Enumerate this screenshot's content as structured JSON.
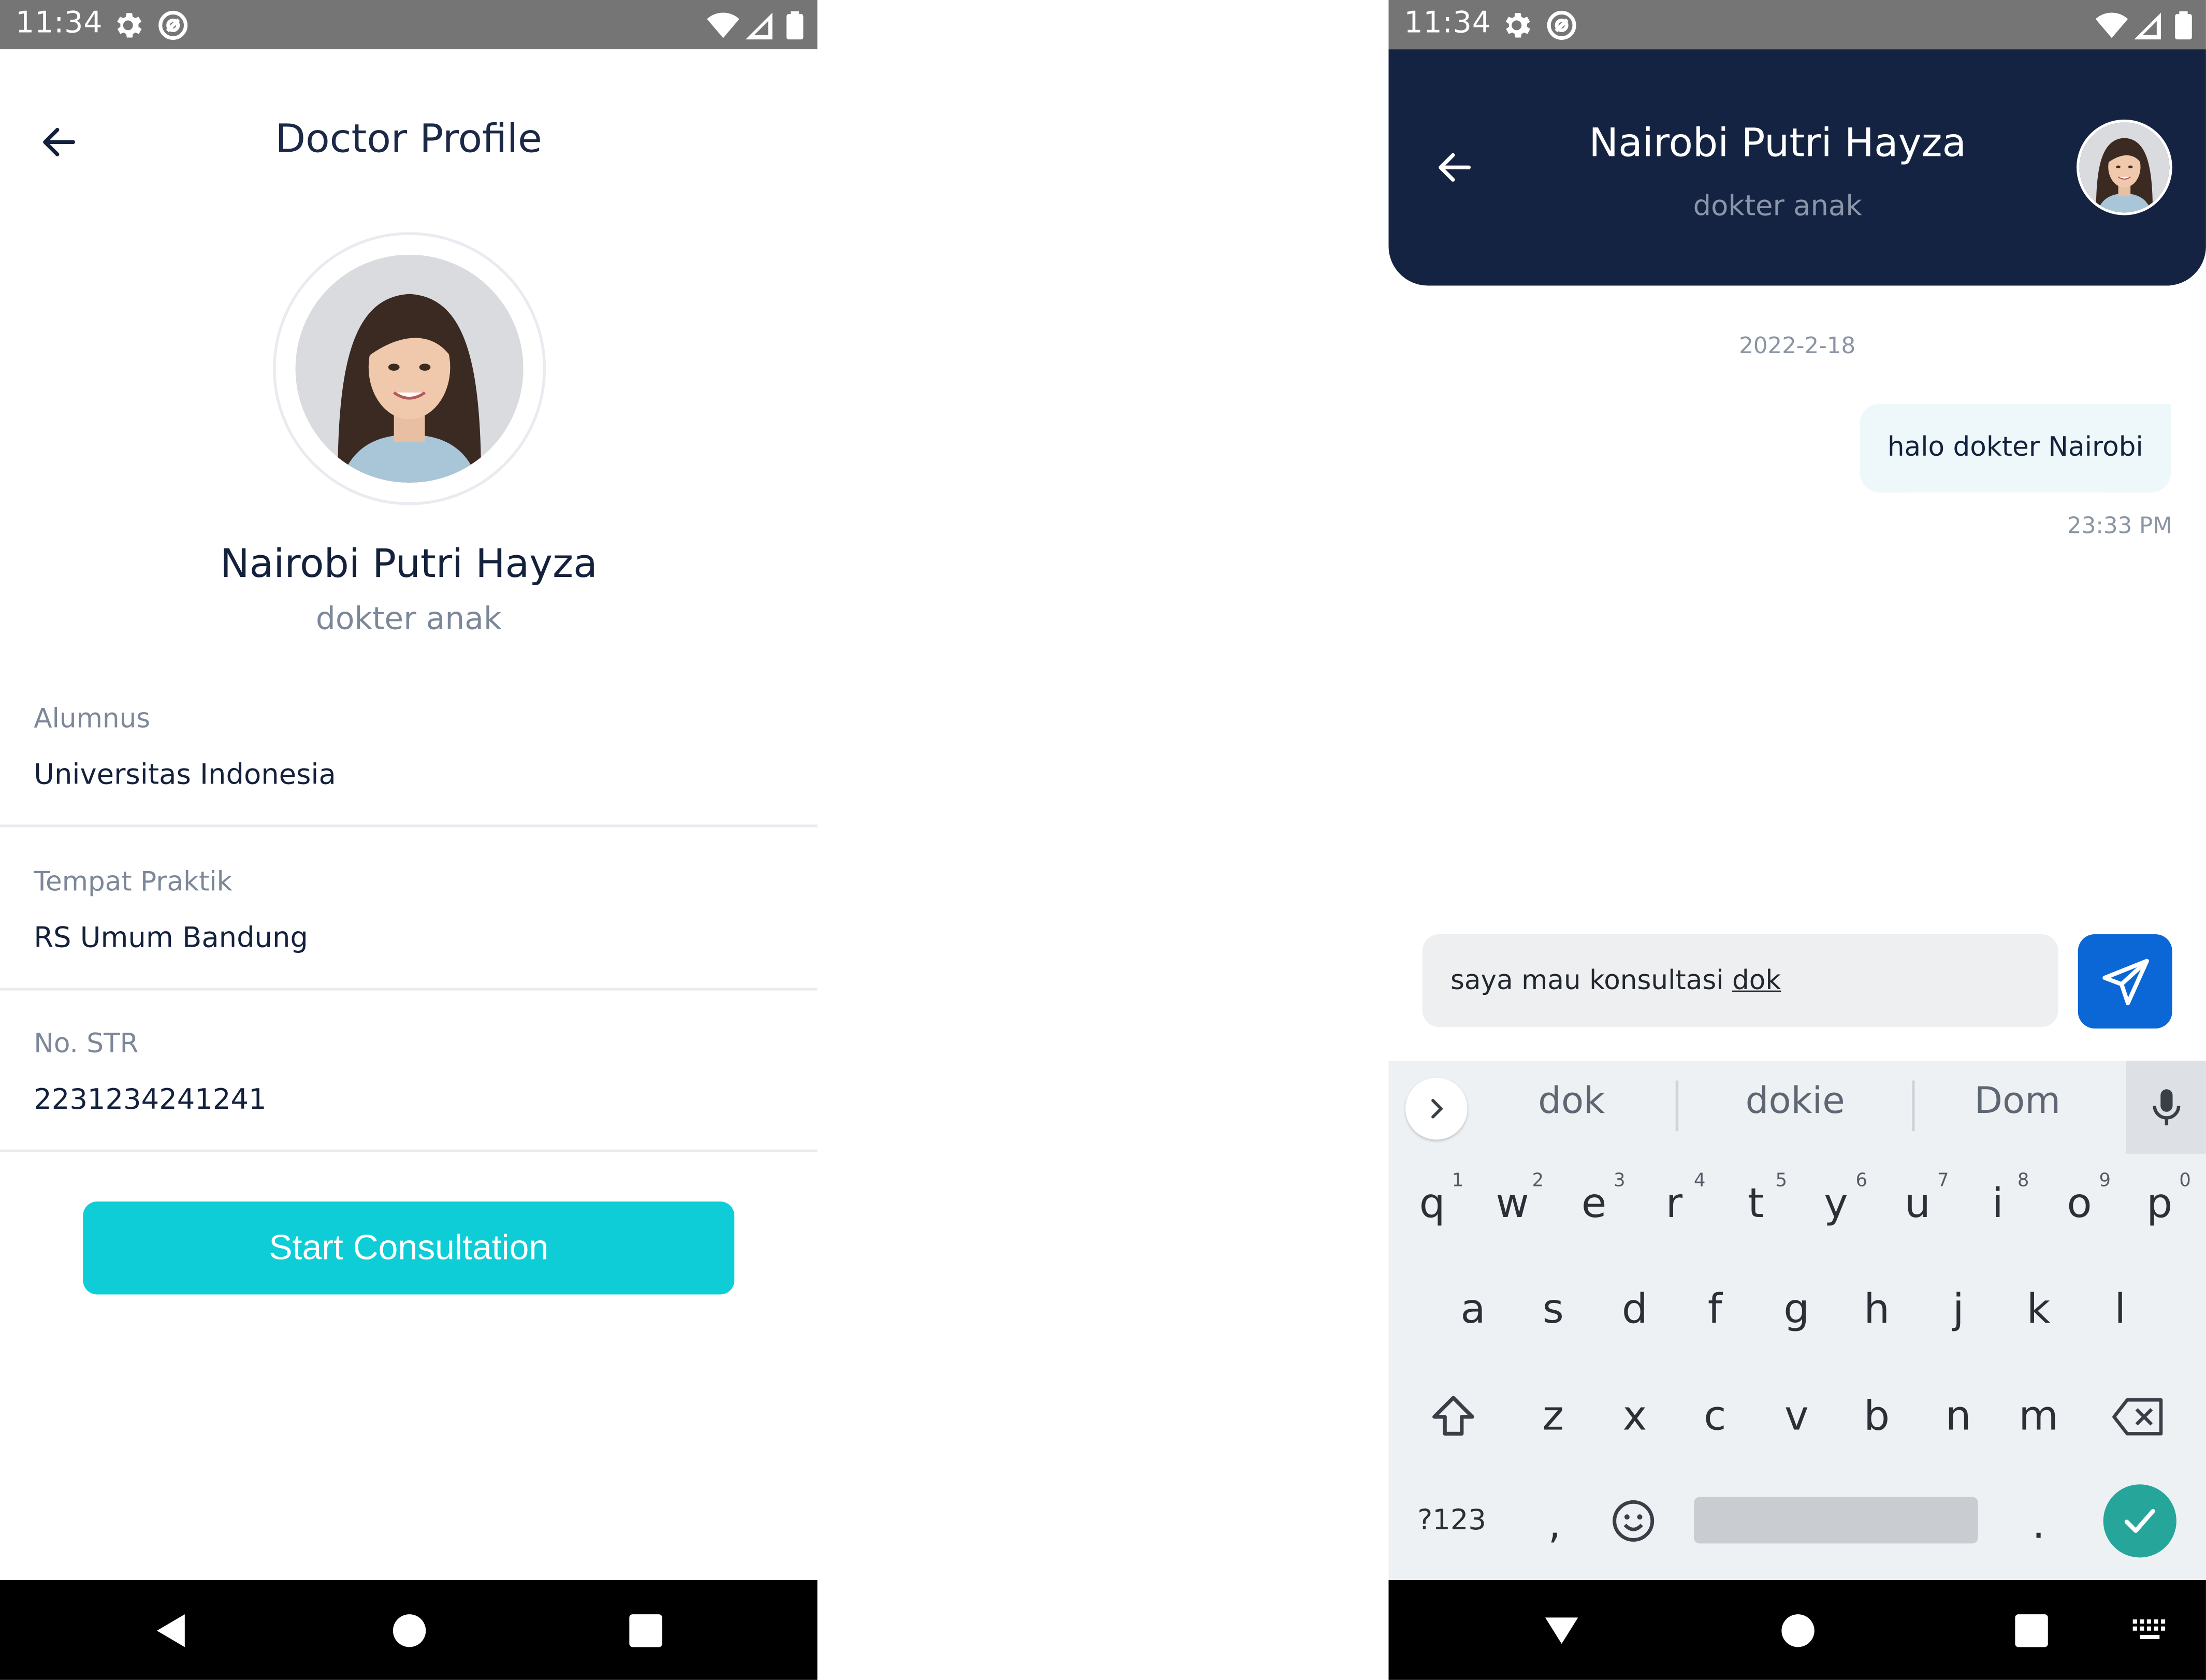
{
  "status_bar": {
    "time": "11:34"
  },
  "profile_screen": {
    "title": "Doctor Profile",
    "doctor": {
      "name": "Nairobi Putri Hayza",
      "specialty": "dokter anak"
    },
    "info": [
      {
        "label": "Alumnus",
        "value": "Universitas Indonesia"
      },
      {
        "label": "Tempat Praktik",
        "value": "RS Umum Bandung"
      },
      {
        "label": "No. STR",
        "value": "2231234241241"
      }
    ],
    "cta_label": "Start Consultation"
  },
  "chat_screen": {
    "header": {
      "name": "Nairobi Putri Hayza",
      "specialty": "dokter anak"
    },
    "date_separator": "2022-2-18",
    "messages": [
      {
        "text": "halo dokter Nairobi",
        "time": "23:33 PM"
      }
    ],
    "composer": {
      "text_plain": "saya mau konsultasi ",
      "text_underlined": "dok"
    },
    "keyboard": {
      "suggestions": [
        "dok",
        "dokie",
        "Dom"
      ],
      "row1": [
        "q",
        "w",
        "e",
        "r",
        "t",
        "y",
        "u",
        "i",
        "o",
        "p"
      ],
      "row1_hints": [
        "1",
        "2",
        "3",
        "4",
        "5",
        "6",
        "7",
        "8",
        "9",
        "0"
      ],
      "row2": [
        "a",
        "s",
        "d",
        "f",
        "g",
        "h",
        "j",
        "k",
        "l"
      ],
      "row3": [
        "z",
        "x",
        "c",
        "v",
        "b",
        "n",
        "m"
      ],
      "symbols_key": "?123",
      "comma_key": ",",
      "period_key": "."
    }
  },
  "colors": {
    "navy": "#142341",
    "cyan_button": "#0ecdd6",
    "send_blue": "#0b66d6",
    "enter_green": "#26a69a",
    "status_gray": "#757575"
  },
  "icons": [
    "gear-icon",
    "at-icon",
    "wifi-icon",
    "signal-icon",
    "battery-icon",
    "back-arrow-icon",
    "send-icon",
    "chevron-right-icon",
    "mic-icon",
    "shift-icon",
    "backspace-icon",
    "emoji-icon",
    "check-icon",
    "nav-back-icon",
    "nav-home-icon",
    "nav-recents-icon",
    "keyboard-hide-icon"
  ]
}
